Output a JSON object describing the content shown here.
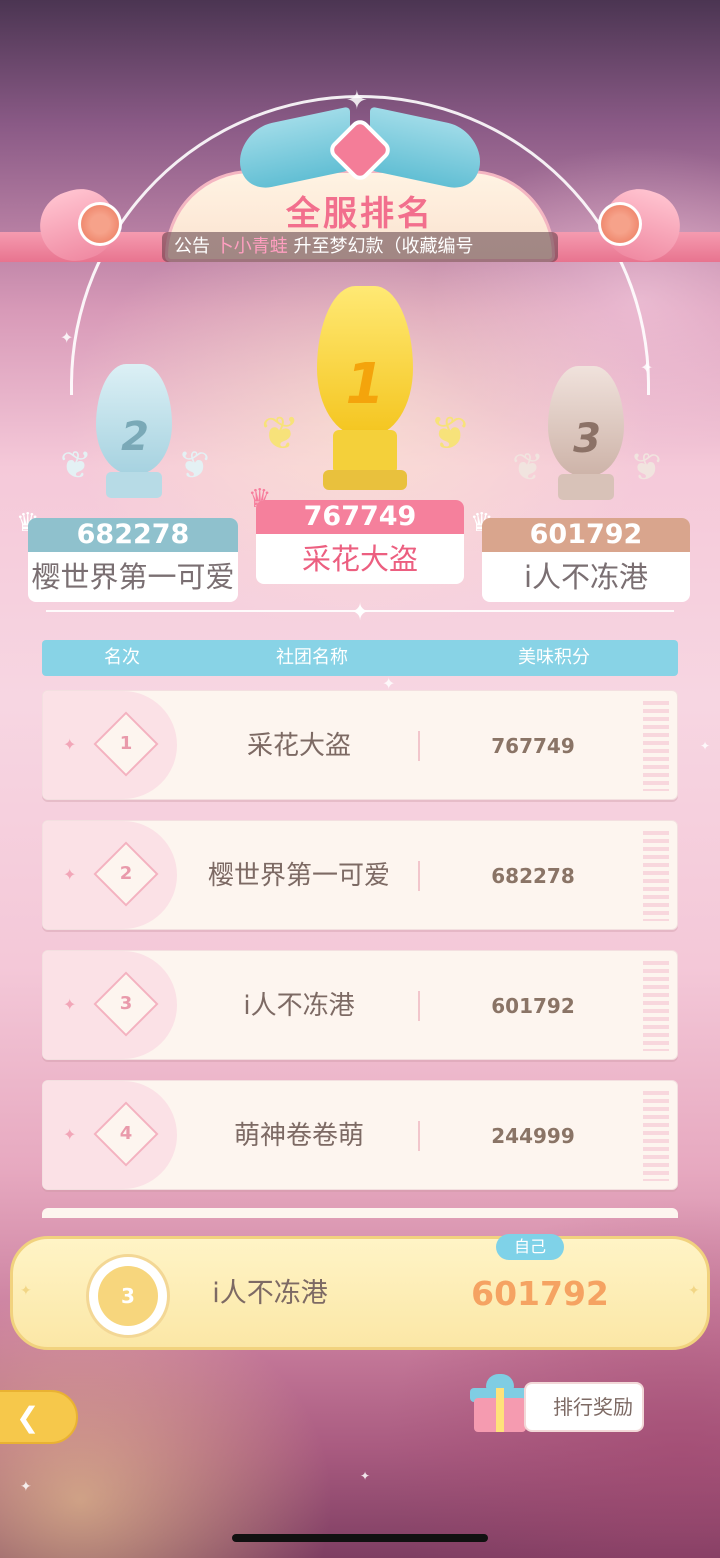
{
  "header": {
    "title": "全服排名",
    "announcement_prefix": "公告",
    "announcement_name": "卜小青蛙",
    "announcement_text": "升至梦幻款（收藏编号"
  },
  "podium": [
    {
      "place": "1",
      "score": "767749",
      "club": "采花大盗",
      "color": "#f4d23e"
    },
    {
      "place": "2",
      "score": "682278",
      "club": "樱世界第一可爱",
      "color": "#a9d5e3"
    },
    {
      "place": "3",
      "score": "601792",
      "club": "i人不冻港",
      "color": "#d6bdb4"
    }
  ],
  "table": {
    "col_rank": "名次",
    "col_club": "社团名称",
    "col_score": "美味积分",
    "rows": [
      {
        "rank": "1",
        "club": "采花大盗",
        "score": "767749"
      },
      {
        "rank": "2",
        "club": "樱世界第一可爱",
        "score": "682278"
      },
      {
        "rank": "3",
        "club": "i人不冻港",
        "score": "601792"
      },
      {
        "rank": "4",
        "club": "萌神卷卷萌",
        "score": "244999"
      }
    ]
  },
  "self": {
    "tag": "自己",
    "rank": "3",
    "club": "i人不冻港",
    "score": "601792"
  },
  "buttons": {
    "reward": "排行奖励",
    "back_icon": "back-arrow-icon",
    "gift_icon": "gift-box-icon"
  }
}
